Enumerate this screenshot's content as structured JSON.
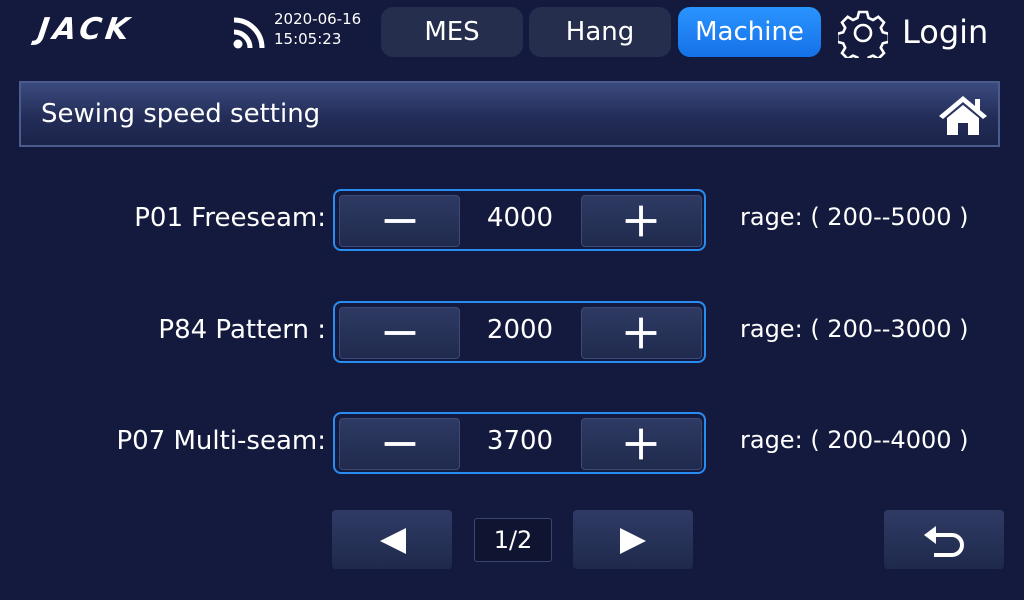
{
  "topbar": {
    "logo": "JACK",
    "date": "2020-06-16",
    "time": "15:05:23",
    "tabs": [
      {
        "label": "MES"
      },
      {
        "label": "Hang"
      },
      {
        "label": "Machine",
        "active": true
      }
    ],
    "login_label": "Login",
    "icons": {
      "wifi": "wifi-icon",
      "settings": "gear-icon"
    }
  },
  "header": {
    "title": "Sewing speed setting",
    "home_icon": "home-icon"
  },
  "params": [
    {
      "label": "P01 Freeseam:",
      "value": "4000",
      "range_label": "rage:",
      "range": "( 200--5000 )"
    },
    {
      "label": "P84 Pattern :",
      "value": "2000",
      "range_label": "rage:",
      "range": "( 200--3000 )"
    },
    {
      "label": "P07 Multi-seam:",
      "value": "3700",
      "range_label": "rage:",
      "range": "( 200--4000 )"
    }
  ],
  "pager": {
    "text": "1/2",
    "current": 1,
    "total": 2
  },
  "colors": {
    "background": "#141a3d",
    "accent": "#2a8cf0",
    "active_tab": "#1f86f8"
  }
}
